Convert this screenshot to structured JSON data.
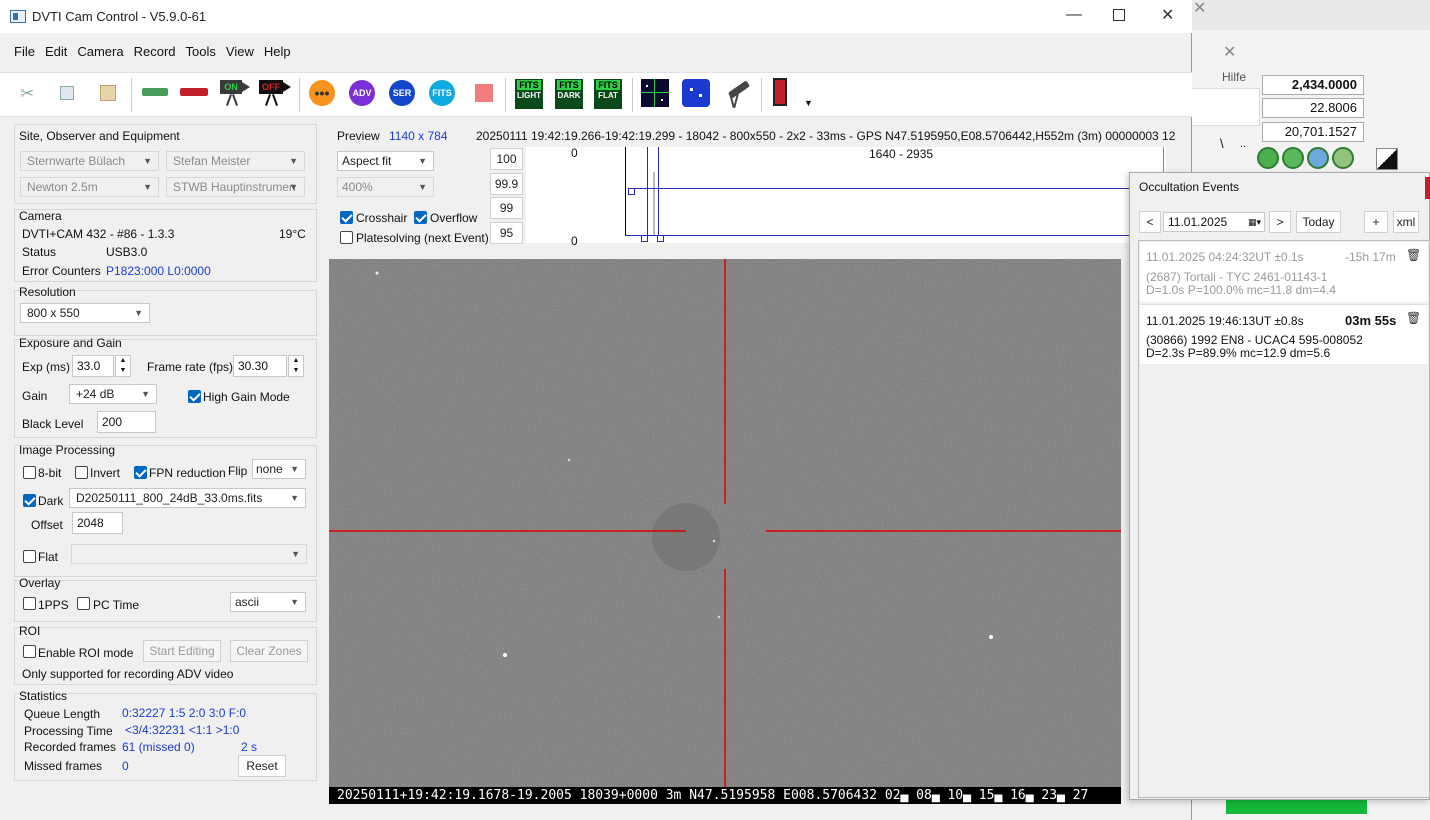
{
  "window": {
    "title": "DVTI Cam Control - V5.9.0-61"
  },
  "menu": [
    "File",
    "Edit",
    "Camera",
    "Record",
    "Tools",
    "View",
    "Help"
  ],
  "toolbar": {
    "on_label": "ON",
    "off_label": "OFF",
    "adv": "ADV",
    "ser": "SER",
    "fits": "FITS",
    "fits_light": "LIGHT",
    "fits_dark": "DARK",
    "fits_flat": "FLAT",
    "fits_word": "FITS"
  },
  "site": {
    "title": "Site, Observer and Equipment",
    "site": "Sternwarte Bülach",
    "observer": "Stefan Meister",
    "telescope": "Newton 2.5m",
    "instrument": "STWB Hauptinstrumen"
  },
  "camera": {
    "title": "Camera",
    "model": "DVTI+CAM 432  -  #86  -  1.3.3",
    "temp": "19°C",
    "status_label": "Status",
    "status": "USB3.0",
    "errors_label": "Error Counters",
    "errors": "P1823:000 L0:0000"
  },
  "resolution": {
    "title": "Resolution",
    "value": "800 x 550"
  },
  "exposure": {
    "title": "Exposure and Gain",
    "exp_label": "Exp (ms)",
    "exp": "33.0",
    "fps_label": "Frame rate (fps)",
    "fps": "30.30",
    "gain_label": "Gain",
    "gain": "+24 dB",
    "high_gain": "High Gain Mode",
    "black_label": "Black Level",
    "black": "200"
  },
  "processing": {
    "title": "Image Processing",
    "bit8": "8-bit",
    "invert": "Invert",
    "fpn": "FPN reduction",
    "flip_label": "Flip",
    "flip": "none",
    "dark": "Dark",
    "dark_file": "D20250111_800_24dB_33.0ms.fits",
    "offset_label": "Offset",
    "offset": "2048",
    "flat": "Flat"
  },
  "overlay": {
    "title": "Overlay",
    "pps": "1PPS",
    "pctime": "PC Time",
    "mode": "ascii"
  },
  "roi": {
    "title": "ROI",
    "enable": "Enable ROI mode",
    "start": "Start Editing",
    "clear": "Clear Zones",
    "note": "Only supported for recording ADV video"
  },
  "stats": {
    "title": "Statistics",
    "queue_label": "Queue Length",
    "queue": "0:32227  1:5  2:0  3:0  F:0",
    "proc_label": "Processing Time",
    "proc": "<3/4:32231  <1:1  >1:0",
    "rec_label": "Recorded frames",
    "rec": "61 (missed 0)",
    "rec_time": "2 s",
    "missed_label": "Missed frames",
    "missed": "0",
    "reset": "Reset"
  },
  "preview": {
    "label": "Preview",
    "size": "1140 x 784",
    "info": "20250111 19:42:19.266-19:42:19.299 - 18042 - 800x550 - 2x2 - 33ms - GPS N47.5195950,E08.5706442,H552m (3m) 00000003 12 -",
    "fit": "Aspect fit",
    "zoom": "400%",
    "crosshair": "Crosshair",
    "overflow": "Overflow",
    "platesolving": "Platesolving (next Event)",
    "levels": [
      "100",
      "99.9",
      "99",
      "95"
    ],
    "hist_top": "0",
    "hist_bottom": "0",
    "hist_range": "1640 - 2935"
  },
  "osd": "20250111+19:42:19.1678-19.2005 18039+0000    3m N47.5195958 E008.5706432 02▄ 08▄ 10▄ 15▄ 16▄ 23▄ 27",
  "background_app": {
    "help": "Hilfe",
    "v1": "2,434.0000",
    "v2": "22.8006",
    "v3": "20,701.1527",
    "backslash": "\\",
    "dots": ".."
  },
  "occultation": {
    "title": "Occultation Events",
    "prev": "<",
    "date": "11.01.2025",
    "next": ">",
    "today": "Today",
    "add": "+",
    "xml": "xml",
    "events": [
      {
        "time": "11.01.2025 04:24:32UT ±0.1s",
        "delta": "-15h 17m",
        "object": "(2687) Tortali - TYC 2461-01143-1",
        "params": "D=1.0s  P=100.0%  mc=11.8  dm=4.4"
      },
      {
        "time": "11.01.2025 19:46:13UT ±0.8s",
        "delta": "03m 55s",
        "object": "(30866) 1992 EN8 - UCAC4 595-008052",
        "params": "D=2.3s  P=89.9%  mc=12.9  dm=5.6"
      }
    ]
  }
}
